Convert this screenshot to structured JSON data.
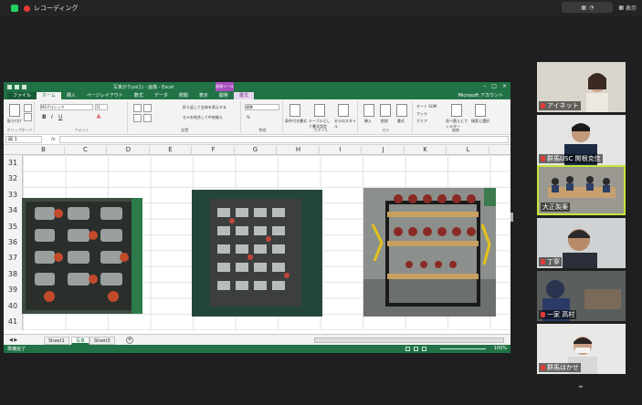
{
  "zoom": {
    "recording_label": "レコーディング",
    "view_label": "表示"
  },
  "excel": {
    "title": "写真がりyo(1) - 画像 - Excel",
    "context_group": "画像ツール",
    "tabs": [
      "ファイル",
      "ホーム",
      "挿入",
      "ページレイアウト",
      "数式",
      "データ",
      "校閲",
      "表示",
      "開発",
      "書式"
    ],
    "account": "Microsoft アカウント",
    "ribbon": {
      "groups": [
        "クリップボード",
        "フォント",
        "配置",
        "数値",
        "スタイル",
        "セル",
        "編集"
      ],
      "font_name": "MS Pゴシック",
      "font_size": "11",
      "number_format": "標準",
      "wrap_text": "折り返して全体を表示する",
      "merge": "セルを結合して中央揃え",
      "cond_format": "条件付き書式",
      "table_format": "テーブルとして書式設定",
      "cell_style": "セルのスタイル",
      "insert": "挿入",
      "delete": "削除",
      "format": "書式",
      "autosum": "オート SUM",
      "fill": "フィル",
      "clear": "クリア",
      "sort": "並べ替えとフィルター",
      "find": "検索と選択",
      "paste": "貼り付け"
    },
    "name_box": "図 1",
    "fx": "fx",
    "columns": [
      "B",
      "C",
      "D",
      "E",
      "F",
      "G",
      "H",
      "I",
      "J",
      "K",
      "L"
    ],
    "rows": [
      "31",
      "32",
      "33",
      "34",
      "35",
      "36",
      "37",
      "38",
      "39",
      "40",
      "41"
    ],
    "sheets": [
      "Sheet1",
      "写真",
      "Sheet3"
    ],
    "active_sheet_index": 1,
    "status": "準備完了",
    "zoom_pct": "100%"
  },
  "participants": [
    {
      "name": "アイネット"
    },
    {
      "name": "群馬USC 関根克佳"
    },
    {
      "name": "大正製薬"
    },
    {
      "name": "丁寧"
    },
    {
      "name": "一家 高村"
    },
    {
      "name": "群馬はかせ"
    }
  ],
  "colors": {
    "excel_green": "#217346",
    "active_tile_border": "#c6e63a",
    "mic_muted": "#e53935"
  }
}
